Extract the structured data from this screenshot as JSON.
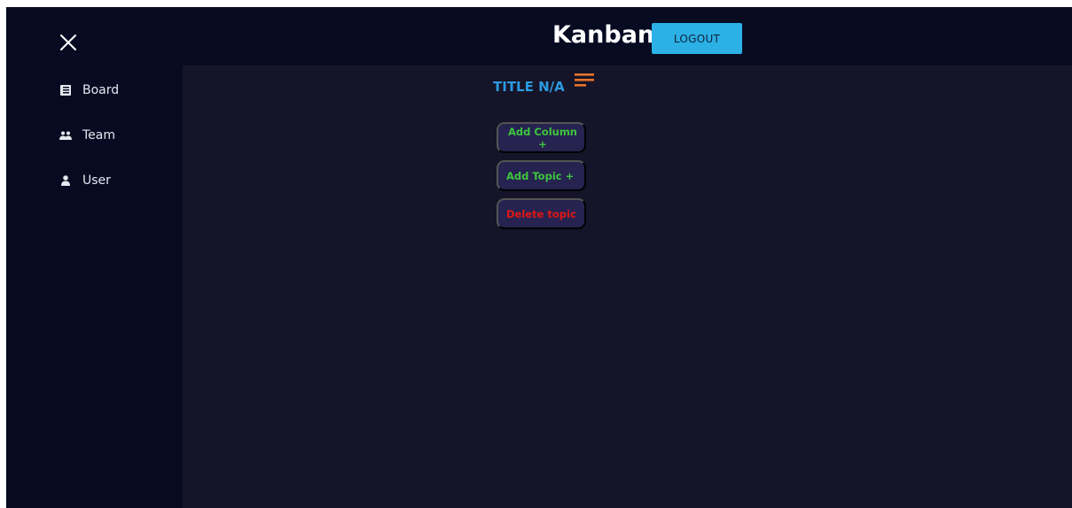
{
  "header": {
    "brand": "Kanban",
    "logout_label": "LOGOUT"
  },
  "sidebar": {
    "close_icon": "close-icon",
    "items": [
      {
        "label": "Board",
        "icon": "board-icon"
      },
      {
        "label": "Team",
        "icon": "team-icon"
      },
      {
        "label": "User",
        "icon": "user-icon"
      }
    ]
  },
  "main": {
    "title": "TITLE N/A",
    "menu_icon": "hamburger-menu-icon",
    "actions": [
      {
        "label": "Add Column +",
        "color": "#3ec53e"
      },
      {
        "label": "Add Topic +",
        "color": "#3ec53e"
      },
      {
        "label": "Delete topic",
        "color": "#e01616"
      }
    ]
  },
  "colors": {
    "accent": "#2cb1e6",
    "title": "#2c9be0",
    "menu_icon": "#e8732a",
    "background": "#161429",
    "sidebar": "#060b22",
    "button_bg": "#262350"
  }
}
